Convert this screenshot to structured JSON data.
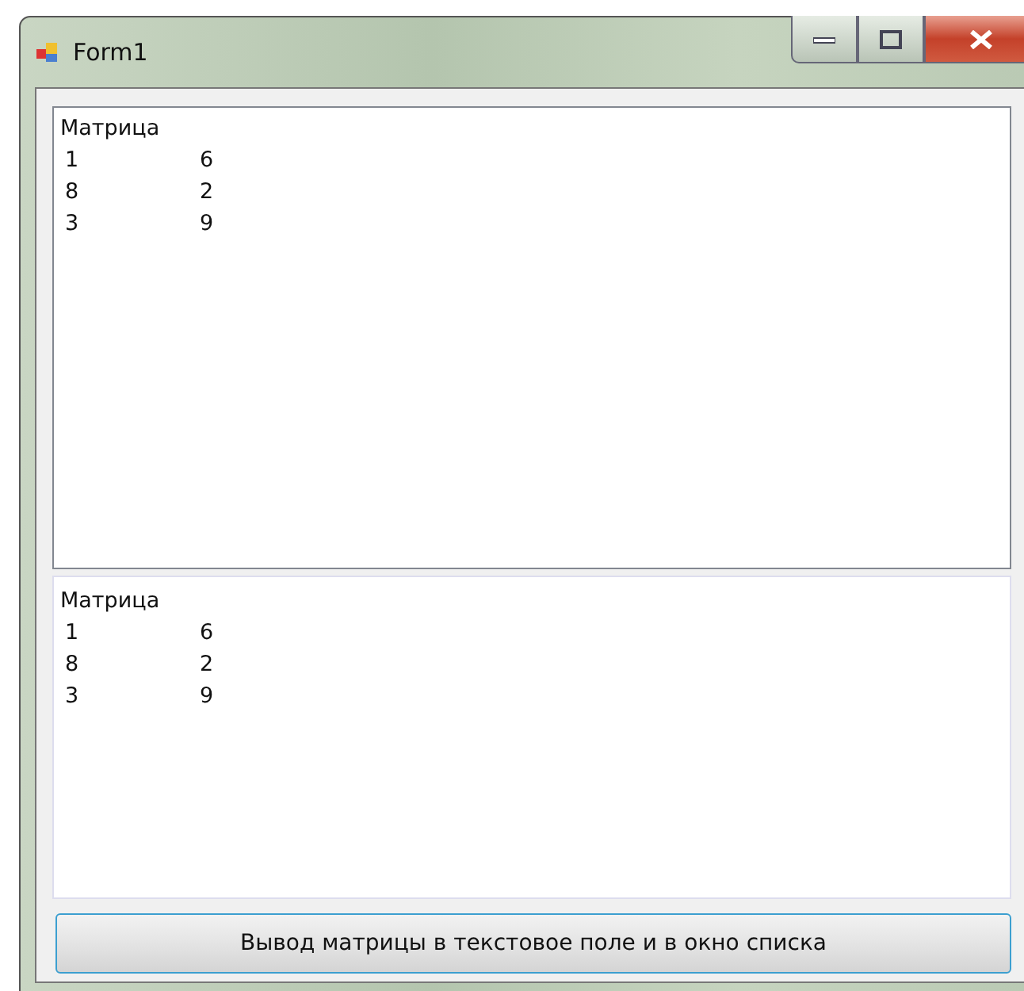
{
  "window": {
    "title": "Form1"
  },
  "text_box": {
    "heading": "Матрица",
    "rows": [
      [
        "1",
        "6"
      ],
      [
        "8",
        "2"
      ],
      [
        "3",
        "9"
      ]
    ]
  },
  "list_box": {
    "heading": "Матрица",
    "rows": [
      [
        "1",
        "6"
      ],
      [
        "8",
        "2"
      ],
      [
        "3",
        "9"
      ]
    ]
  },
  "button": {
    "label": "Вывод матрицы в текстовое поле и в окно списка"
  }
}
